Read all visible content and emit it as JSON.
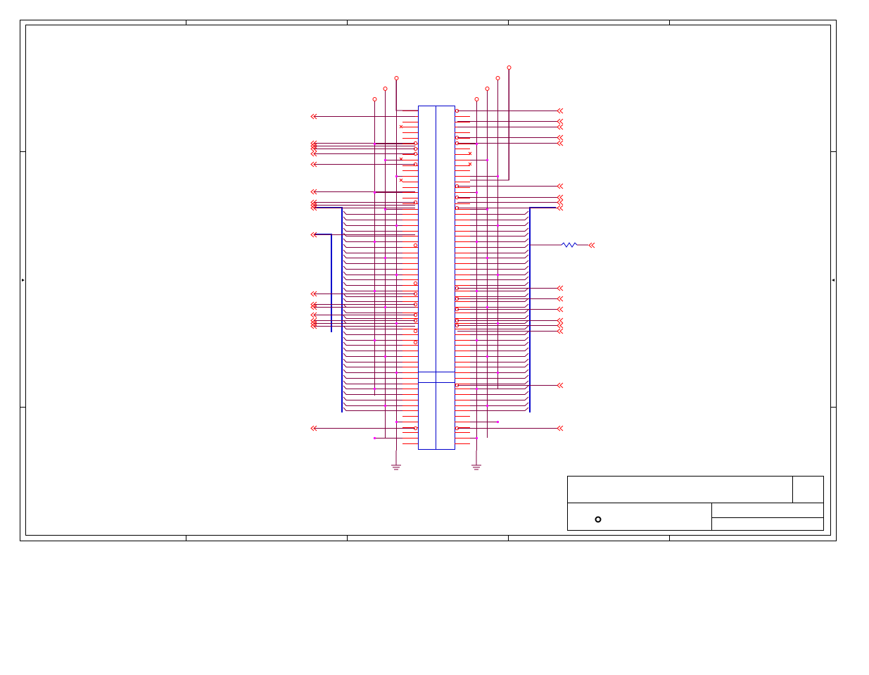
{
  "document": {
    "type": "schematic-sheet",
    "colors": {
      "border": "#000000",
      "wire": "#800040",
      "pin": "#ff0000",
      "bus": "#0000cc",
      "body": "#0000cc",
      "junction": "#ff00ff",
      "ground": "#800040"
    }
  },
  "title_block": {
    "title": "",
    "size": "",
    "document_number": "",
    "revision": "",
    "date": "",
    "sheet": ""
  },
  "icons": {
    "off_page_connector": "double-chevron-left-icon",
    "ground": "ground-icon",
    "resistor": "resistor-icon",
    "power_terminal": "open-circle-icon"
  }
}
